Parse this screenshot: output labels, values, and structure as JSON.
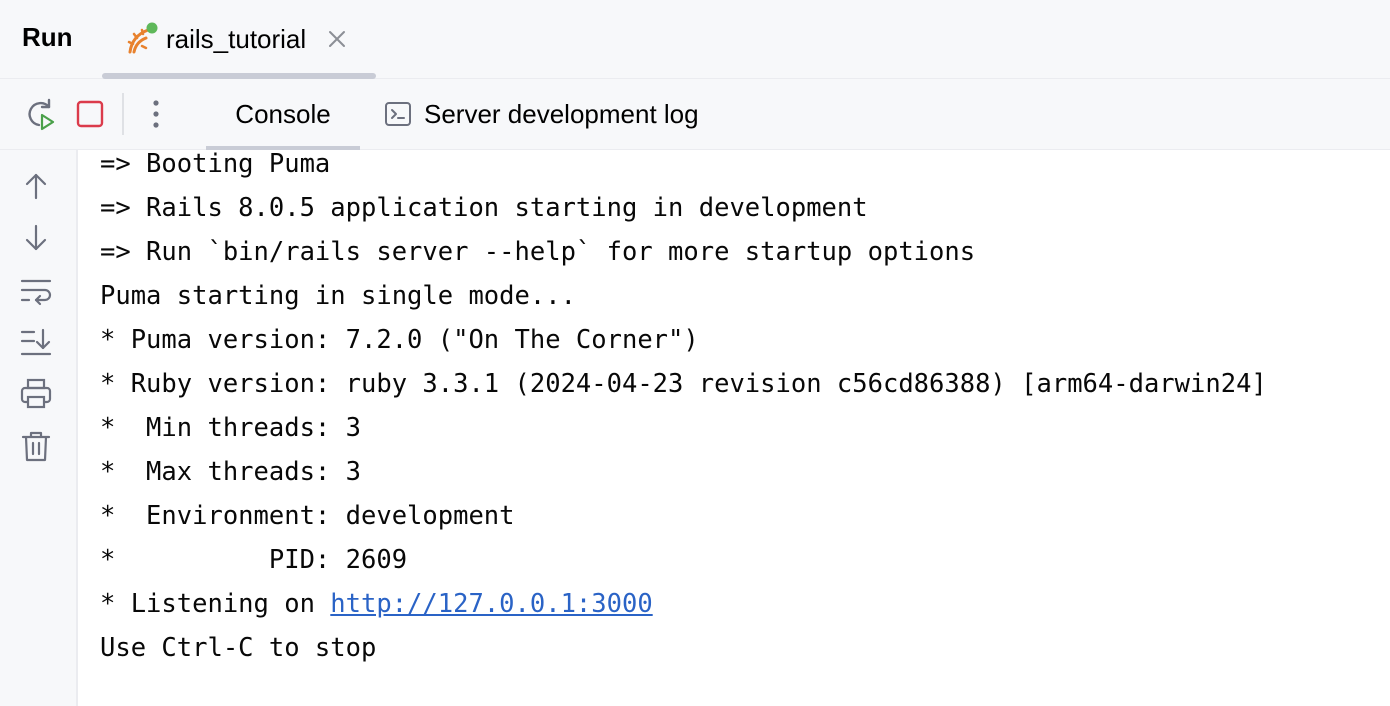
{
  "header": {
    "title": "Run",
    "run_tab": {
      "label": "rails_tutorial",
      "icon": "rails-icon",
      "running_indicator_color": "#5fb85a"
    }
  },
  "toolbar": {
    "rerun_icon": "rerun-icon",
    "stop_icon": "stop-icon",
    "more_icon": "more-vertical-icon",
    "tabs": [
      {
        "label": "Console",
        "active": true
      },
      {
        "label": "Server development log",
        "icon": "terminal-icon",
        "active": false
      }
    ]
  },
  "gutter": {
    "icons": [
      "arrow-up-icon",
      "arrow-down-icon",
      "soft-wrap-icon",
      "scroll-to-end-icon",
      "print-icon",
      "trash-icon"
    ]
  },
  "console": {
    "lines": [
      "=> Booting Puma",
      "=> Rails 8.0.5 application starting in development",
      "=> Run `bin/rails server --help` for more startup options",
      "Puma starting in single mode...",
      "* Puma version: 7.2.0 (\"On The Corner\")",
      "* Ruby version: ruby 3.3.1 (2024-04-23 revision c56cd86388) [arm64-darwin24]",
      "*  Min threads: 3",
      "*  Max threads: 3",
      "*  Environment: development",
      "*          PID: 2609"
    ],
    "listening_prefix": "* Listening on ",
    "listening_url": "http://127.0.0.1:3000",
    "last_line": "Use Ctrl-C to stop"
  },
  "colors": {
    "stop_red": "#db3b4b",
    "rerun_green": "#4aa04a",
    "link_blue": "#2a63c6",
    "rails_orange": "#e8822e"
  }
}
